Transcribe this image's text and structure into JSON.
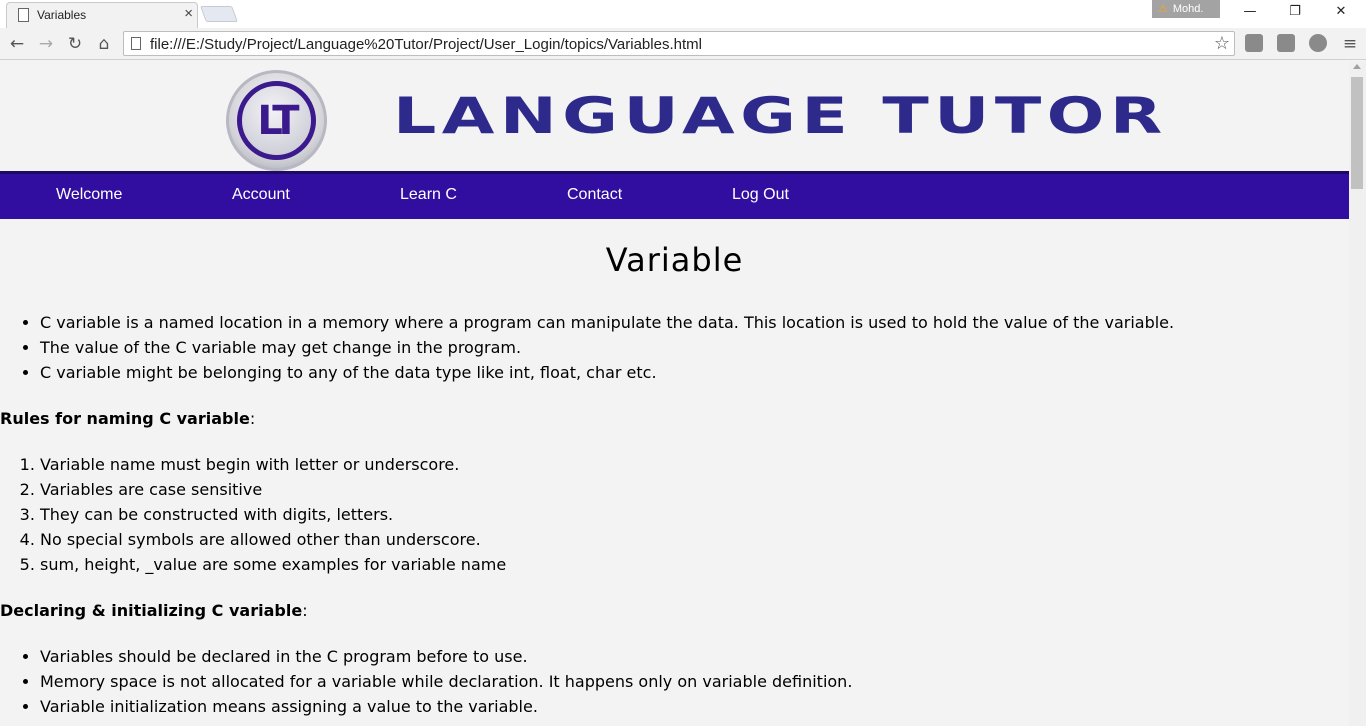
{
  "browser": {
    "tab_title": "Variables",
    "tab_close": "×",
    "profile_name": "Mohd.",
    "url": "file:///E:/Study/Project/Language%20Tutor/Project/User_Login/topics/Variables.html",
    "minimize": "—",
    "restore": "❐",
    "close": "✕"
  },
  "header": {
    "logo_text": "LT",
    "brand": "LANGUAGE TUTOR"
  },
  "nav": {
    "items": [
      "Welcome",
      "Account",
      "Learn C",
      "Contact",
      "Log Out"
    ]
  },
  "content": {
    "title": "Variable",
    "intro_list": [
      "C variable is a named location in a memory where a program can manipulate the data. This location is used to hold the value of the variable.",
      "The value of the C variable may get change in the program.",
      "C variable might be belonging to any of the data type like int, float, char etc."
    ],
    "rules_heading": "Rules for naming C variable",
    "rules_colon": ":",
    "rules_list": [
      "Variable name must begin with letter or underscore.",
      "Variables are case sensitive",
      "They can be constructed with digits, letters.",
      "No special symbols are allowed other than underscore.",
      "sum, height, _value are some examples for variable name"
    ],
    "declare_heading": "Declaring & initializing C variable",
    "declare_colon": ":",
    "declare_list": [
      "Variables should be declared in the C program before to use.",
      "Memory space is not allocated for a variable while declaration. It happens only on variable definition.",
      "Variable initialization means assigning a value to the variable."
    ]
  },
  "colors": {
    "nav_bg": "#310ea0",
    "brand_text": "#2d2a8c",
    "page_bg": "#f3f3f3"
  }
}
